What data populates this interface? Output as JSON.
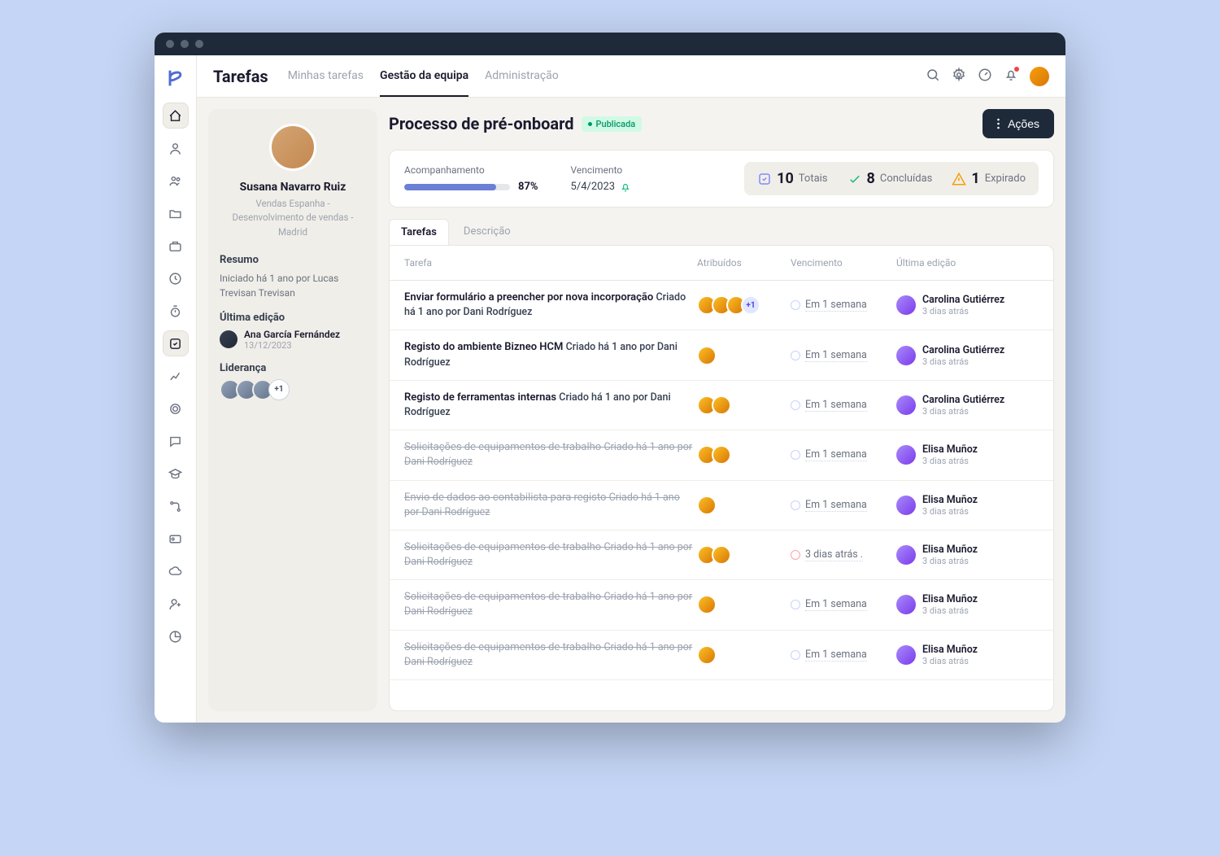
{
  "header": {
    "title": "Tarefas",
    "tabs": [
      "Minhas tarefas",
      "Gestão da equipa",
      "Administração"
    ],
    "active_tab": 1
  },
  "profile": {
    "name": "Susana Navarro Ruiz",
    "subtitle": "Vendas Espanha - Desenvolvimento de vendas - Madrid",
    "summary_label": "Resumo",
    "summary_text": "Iniciado há 1 ano por Lucas Trevisan Trevisan",
    "last_edit_label": "Última edição",
    "last_editor_name": "Ana García Fernández",
    "last_editor_date": "13/12/2023",
    "leadership_label": "Liderança",
    "leadership_more": "+1"
  },
  "workspace": {
    "title": "Processo de pré-onboard",
    "status": "Publicada",
    "actions_label": "Ações",
    "tracking_label": "Acompanhamento",
    "tracking_pct": "87%",
    "due_label": "Vencimento",
    "due_date": "5/4/2023",
    "kpis": {
      "total_num": "10",
      "total_label": "Totais",
      "done_num": "8",
      "done_label": "Concluídas",
      "expired_num": "1",
      "expired_label": "Expirado"
    },
    "subtabs": [
      "Tarefas",
      "Descrição"
    ],
    "active_subtab": 0
  },
  "table": {
    "headers": {
      "task": "Tarefa",
      "assigned": "Atribuídos",
      "due": "Vencimento",
      "edited": "Última edição"
    },
    "rows": [
      {
        "title": "Enviar formulário a preencher por nova incorporação",
        "meta": "Criado há 1 ano por Dani Rodríguez",
        "done": false,
        "assignees": 3,
        "more": "+1",
        "due": "Em 1 semana",
        "expired": false,
        "editor": "Carolina Gutiérrez",
        "edited": "3 dias atrás"
      },
      {
        "title": "Registo do ambiente Bizneo HCM",
        "meta": "Criado há 1 ano por Dani Rodríguez",
        "done": false,
        "assignees": 1,
        "more": null,
        "due": "Em 1 semana",
        "expired": false,
        "editor": "Carolina Gutiérrez",
        "edited": "3 dias atrás"
      },
      {
        "title": "Registo de ferramentas internas",
        "meta": "Criado há 1 ano por Dani Rodríguez",
        "done": false,
        "assignees": 2,
        "more": null,
        "due": "Em 1 semana",
        "expired": false,
        "editor": "Carolina Gutiérrez",
        "edited": "3 dias atrás"
      },
      {
        "title": "Solicitações de equipamentos de trabalho",
        "meta": "Criado há 1 ano por Dani Rodríguez",
        "done": true,
        "assignees": 2,
        "more": null,
        "due": "Em 1 semana",
        "expired": false,
        "editor": "Elisa Muñoz",
        "edited": "3 dias atrás"
      },
      {
        "title": "Envio de dados ao contabilista para registo",
        "meta": "Criado há 1 ano por Dani Rodríguez",
        "done": true,
        "assignees": 1,
        "more": null,
        "due": "Em 1 semana",
        "expired": false,
        "editor": "Elisa Muñoz",
        "edited": "3 dias atrás"
      },
      {
        "title": "Solicitações de equipamentos de trabalho",
        "meta": "Criado há 1 ano por Dani Rodríguez",
        "done": true,
        "assignees": 2,
        "more": null,
        "due": "3 dias atrás .",
        "expired": true,
        "editor": "Elisa Muñoz",
        "edited": "3 dias atrás"
      },
      {
        "title": "Solicitações de equipamentos de trabalho",
        "meta": "Criado há 1 ano por Dani Rodríguez",
        "done": true,
        "assignees": 1,
        "more": null,
        "due": "Em 1 semana",
        "expired": false,
        "editor": "Elisa Muñoz",
        "edited": "3 dias atrás"
      },
      {
        "title": "Solicitações de equipamentos de trabalho",
        "meta": "Criado há 1 ano por Dani Rodríguez",
        "done": true,
        "assignees": 1,
        "more": null,
        "due": "Em 1 semana",
        "expired": false,
        "editor": "Elisa Muñoz",
        "edited": "3 dias atrás"
      }
    ]
  },
  "colors": {
    "accent": "#6b7fd7",
    "success": "#10b981",
    "warning": "#f59e0b",
    "dark": "#1e2a3a"
  }
}
